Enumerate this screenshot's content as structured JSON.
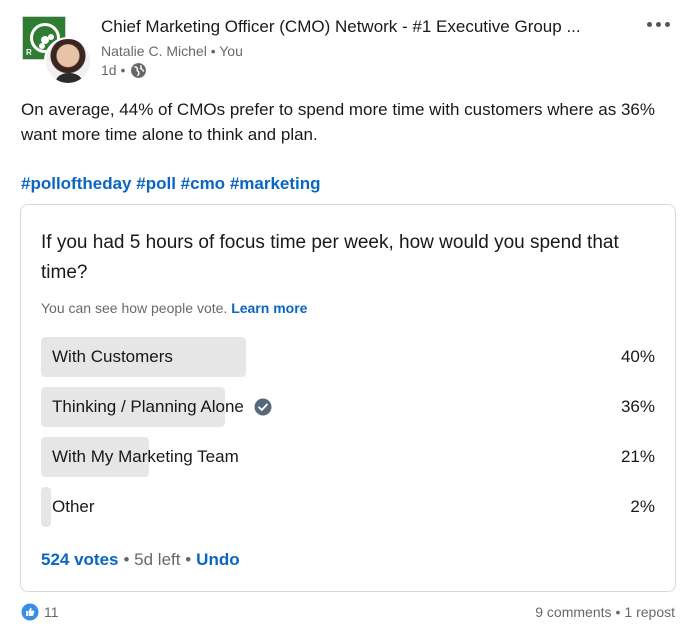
{
  "header": {
    "group_name": "Chief Marketing Officer (CMO) Network - #1 Executive Group ...",
    "author": "Natalie C. Michel • You",
    "time": "1d •",
    "logo_mark": "R"
  },
  "post": {
    "text": "On average, 44% of CMOs prefer to spend more time with customers where as 36% want more time alone to think and plan.",
    "hashtags": [
      "#polloftheday",
      "#poll",
      "#cmo",
      "#marketing"
    ]
  },
  "poll": {
    "question": "If you had 5 hours of focus time per week, how would you spend that time?",
    "note": "You can see how people vote.",
    "learn_more": "Learn more",
    "options": [
      {
        "label": "With Customers",
        "percent": "40%",
        "fill": 0.4,
        "selected": false
      },
      {
        "label": "Thinking / Planning Alone",
        "percent": "36%",
        "fill": 0.36,
        "selected": true
      },
      {
        "label": "With My Marketing Team",
        "percent": "21%",
        "fill": 0.21,
        "selected": false
      },
      {
        "label": "Other",
        "percent": "2%",
        "fill": 0.02,
        "selected": false
      }
    ],
    "votes": "524 votes",
    "time_left": "• 5d left •",
    "undo": "Undo"
  },
  "social": {
    "reaction_count": "11",
    "comments": "9 comments",
    "separator": "•",
    "reposts": "1 repost"
  },
  "colors": {
    "link": "#0a66c2",
    "bar_fill": "#e6e6e6",
    "check": "#56687a",
    "logo_green": "#2e7d32"
  }
}
